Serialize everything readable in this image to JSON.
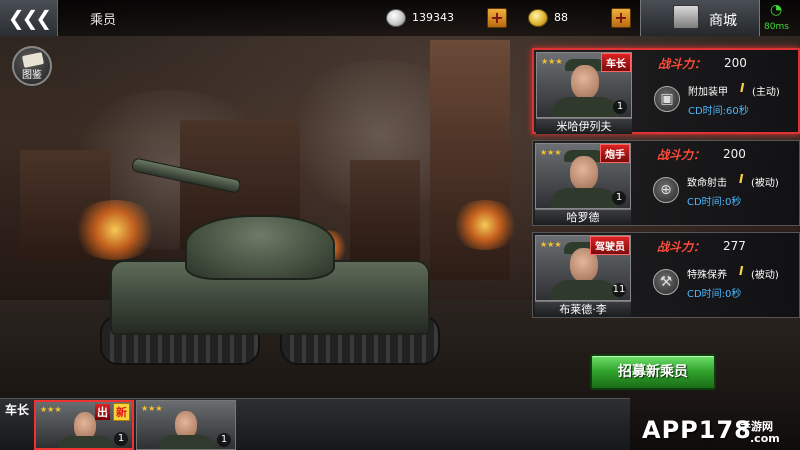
{
  "header": {
    "back_icon": "triple-chevron-left-icon",
    "title": "乘员",
    "silver": "139343",
    "gold": "88",
    "shop_label": "商城",
    "latency": "80ms"
  },
  "catalog_label": "图鉴",
  "crew": [
    {
      "role": "车长",
      "name": "米哈伊列夫",
      "level": "1",
      "power_label": "战斗力：",
      "power": "200",
      "skill_name": "附加装甲",
      "skill_level": "I",
      "skill_type": "(主动)",
      "cooldown": "CD时间:60秒",
      "skill_icon": "armor-plate-icon"
    },
    {
      "role": "炮手",
      "name": "哈罗德",
      "level": "1",
      "power_label": "战斗力：",
      "power": "200",
      "skill_name": "致命射击",
      "skill_level": "I",
      "skill_type": "(被动)",
      "cooldown": "CD时间:0秒",
      "skill_icon": "crosshair-icon"
    },
    {
      "role": "驾驶员",
      "name": "布莱德·李",
      "level": "11",
      "power_label": "战斗力：",
      "power": "277",
      "skill_name": "特殊保养",
      "skill_level": "I",
      "skill_type": "(被动)",
      "cooldown": "CD时间:0秒",
      "skill_icon": "wrench-icon"
    }
  ],
  "recruit_label": "招募新乘员",
  "bottom": {
    "slot_label": "车长",
    "slots": [
      {
        "deploy_tag": "出",
        "new_tag": "新",
        "level": "1"
      },
      {
        "level": "1"
      }
    ]
  },
  "watermark": {
    "main": "APP178",
    "sub": "手游网",
    "com": ".com"
  }
}
